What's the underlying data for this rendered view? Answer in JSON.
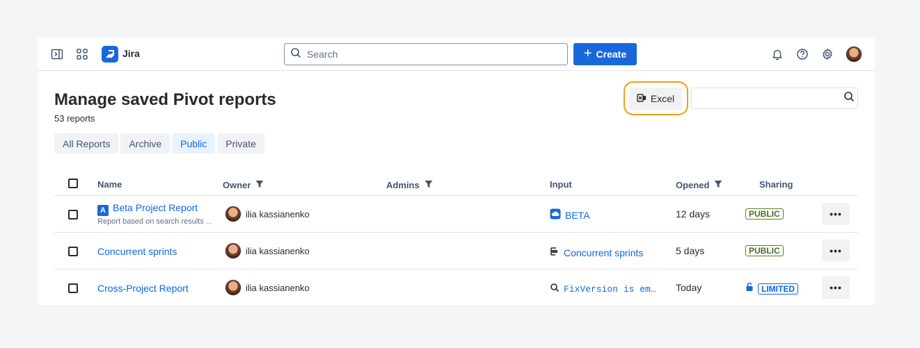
{
  "nav": {
    "brand": "Jira",
    "search_placeholder": "Search",
    "create_label": "Create"
  },
  "page": {
    "title": "Manage saved Pivot reports",
    "count": "53 reports",
    "excel_label": "Excel"
  },
  "tabs": [
    "All Reports",
    "Archive",
    "Public",
    "Private"
  ],
  "active_tab": "Public",
  "table": {
    "headers": {
      "name": "Name",
      "owner": "Owner",
      "admins": "Admins",
      "input": "Input",
      "opened": "Opened",
      "sharing": "Sharing"
    },
    "rows": [
      {
        "badge": "A",
        "name": "Beta Project Report",
        "desc": "Report based on search results ...",
        "owner": "ilia kassianenko",
        "input_icon": "cloud-icon",
        "input": "BETA",
        "opened": "12 days",
        "sharing": "PUBLIC"
      },
      {
        "name": "Concurrent sprints",
        "owner": "ilia kassianenko",
        "input_icon": "board-icon",
        "input": "Concurrent sprints",
        "opened": "5 days",
        "sharing": "PUBLIC"
      },
      {
        "name": "Cross-Project Report",
        "owner": "ilia kassianenko",
        "input_icon": "search-icon",
        "input": "FixVersion is em…",
        "opened": "Today",
        "sharing": "LIMITED"
      }
    ],
    "more_label": "•••"
  },
  "colors": {
    "primary": "#1868db",
    "link": "#0c66e4",
    "highlight": "#f39c12",
    "public_green": "#5b7f24"
  }
}
